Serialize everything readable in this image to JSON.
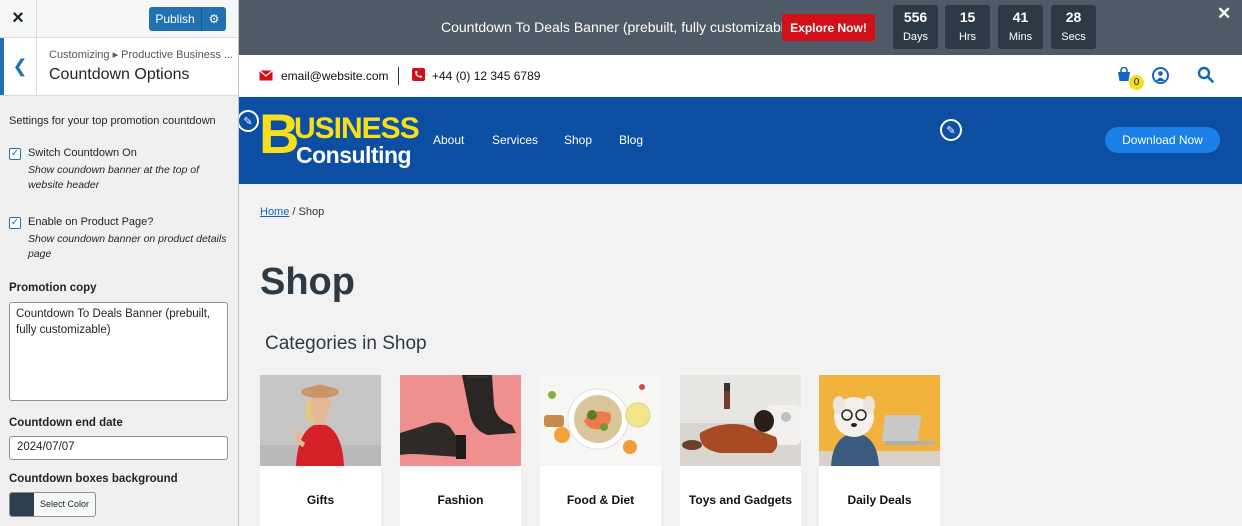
{
  "customizer": {
    "close_label": "×",
    "publish_label": "Publish",
    "breadcrumb": "Customizing ▸ Productive Business ...",
    "section_title": "Countdown Options",
    "description": "Settings for your top promotion countdown",
    "switch_countdown": {
      "label": "Switch Countdown On",
      "help": "Show coundown banner at the top of website header",
      "checked": true
    },
    "product_page": {
      "label": "Enable on Product Page?",
      "help": "Show coundown banner on product details page",
      "checked": true
    },
    "promotion_copy": {
      "label": "Promotion copy",
      "value": "Countdown To Deals Banner (prebuilt, fully customizable)"
    },
    "end_date": {
      "label": "Countdown end date",
      "value": "2024/07/07"
    },
    "box_background": {
      "label": "Countdown boxes background",
      "button_label": "Select Color",
      "color": "#2c3e50"
    }
  },
  "banner": {
    "text": "Countdown To Deals Banner (prebuilt, fully customizable)",
    "button_label": "Explore Now!",
    "countdown": [
      {
        "value": "556",
        "unit": "Days"
      },
      {
        "value": "15",
        "unit": "Hrs"
      },
      {
        "value": "41",
        "unit": "Mins"
      },
      {
        "value": "28",
        "unit": "Secs"
      }
    ],
    "close_label": "✕"
  },
  "topbar": {
    "email": "email@website.com",
    "phone": "+44 (0) 12 345 6789",
    "cart_count": "0"
  },
  "header": {
    "logo_b": "B",
    "logo_usiness": "USINESS",
    "logo_consulting": "Consulting",
    "nav": [
      "About",
      "Services",
      "Shop",
      "Blog"
    ],
    "cta_label": "Download Now"
  },
  "page": {
    "breadcrumb_home": "Home",
    "breadcrumb_sep": " / ",
    "breadcrumb_current": "Shop",
    "title": "Shop",
    "categories_heading": "Categories in Shop",
    "categories": [
      {
        "name": "Gifts"
      },
      {
        "name": "Fashion"
      },
      {
        "name": "Food & Diet"
      },
      {
        "name": "Toys and Gadgets"
      },
      {
        "name": "Daily Deals"
      }
    ]
  }
}
